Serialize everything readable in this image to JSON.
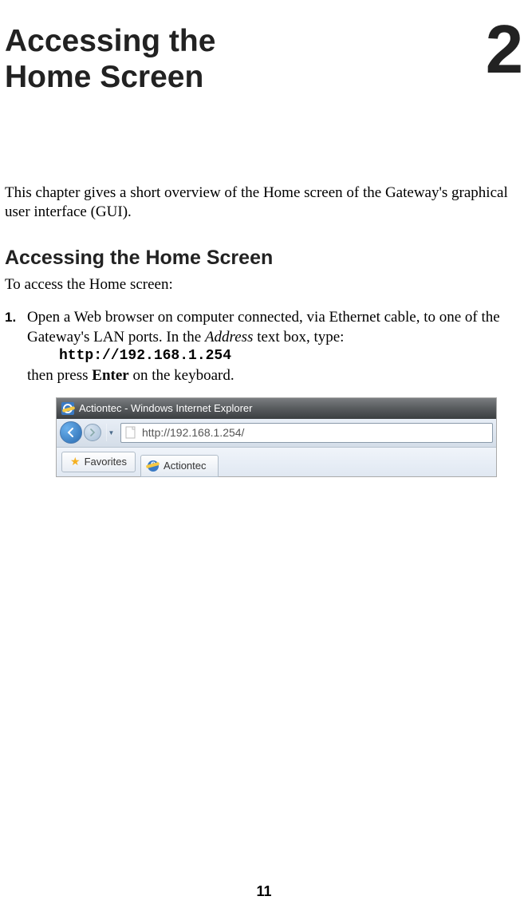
{
  "chapter": {
    "title_line1": "Accessing the",
    "title_line2": "Home Screen",
    "number": "2"
  },
  "intro": "This chapter gives a short overview of the Home screen of the Gateway's graphical user interface (GUI).",
  "section": {
    "title": "Accessing the Home Screen",
    "lead": "To access the Home screen:"
  },
  "step1": {
    "number": "1.",
    "text_a": "Open a Web browser on computer connected, via Ethernet cable, to one of the Gateway's LAN ports. In the ",
    "text_italic": "Address",
    "text_b": " text box, type:",
    "url": "http://192.168.1.254",
    "text_c": "then press ",
    "text_bold": "Enter",
    "text_d": " on the keyboard."
  },
  "screenshot": {
    "window_title": "Actiontec - Windows Internet Explorer",
    "address_url": "http://192.168.1.254/",
    "favorites_label": "Favorites",
    "tab_label": "Actiontec"
  },
  "page_number": "11"
}
